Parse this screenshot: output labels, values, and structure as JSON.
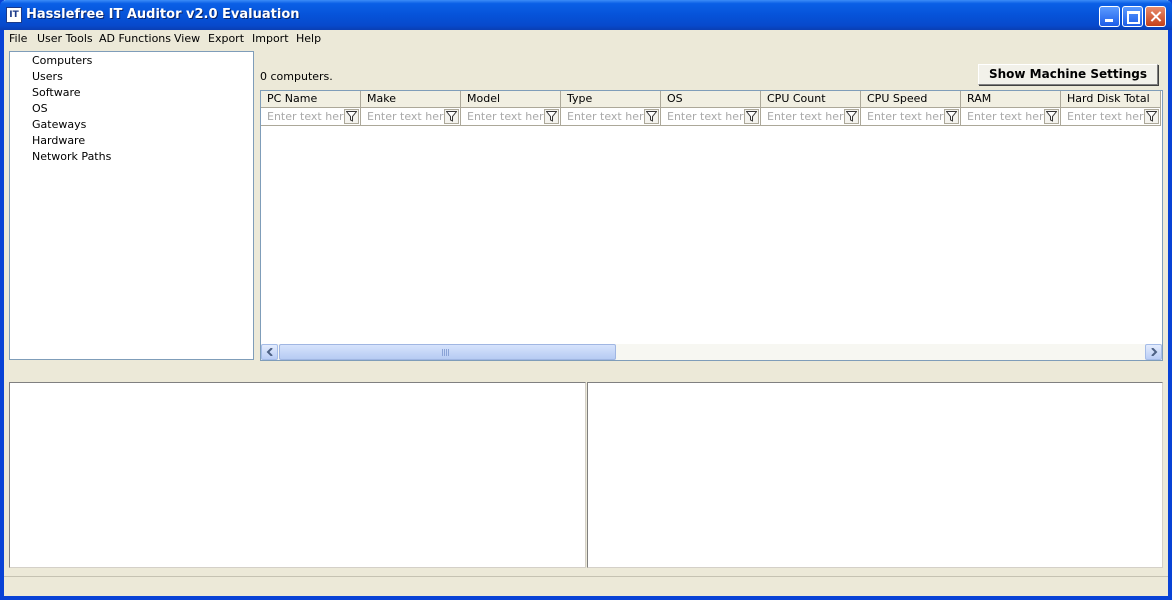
{
  "window": {
    "title": "Hasslefree IT Auditor v2.0 Evaluation",
    "app_icon_text": "IT"
  },
  "menu": [
    "File",
    "User Tools",
    "AD Functions",
    "View",
    "Export",
    "Import",
    "Help"
  ],
  "tree": {
    "items": [
      "Computers",
      "Users",
      "Software",
      "OS",
      "Gateways",
      "Hardware",
      "Network Paths"
    ]
  },
  "main": {
    "count_label": "0 computers.",
    "show_settings_label": "Show Machine Settings"
  },
  "grid": {
    "columns": [
      "PC Name",
      "Make",
      "Model",
      "Type",
      "OS",
      "CPU Count",
      "CPU Speed",
      "RAM",
      "Hard Disk Total"
    ],
    "filter_placeholder": "Enter text here",
    "rows": []
  },
  "colors": {
    "titlebar": "#0653d9",
    "window_bg": "#ece9d8",
    "border": "#7f9db9"
  }
}
